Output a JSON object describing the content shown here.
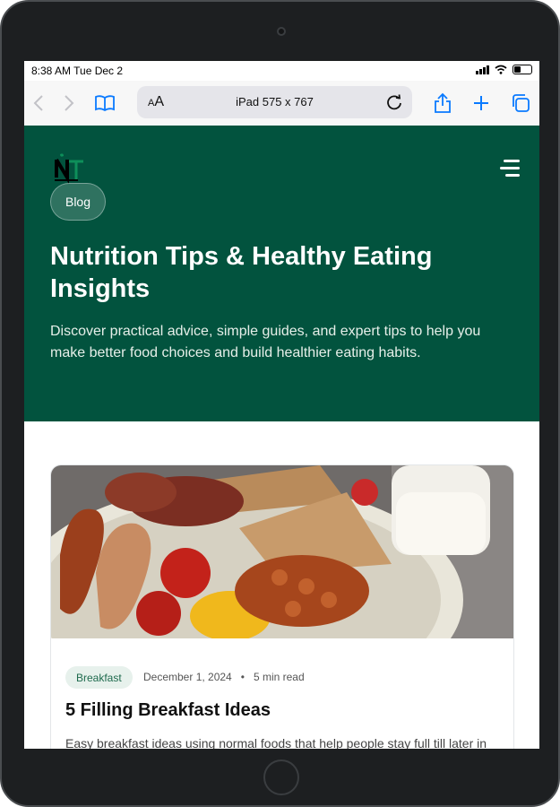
{
  "status_bar": {
    "time": "8:38 AM  Tue Dec 2"
  },
  "browser": {
    "text_size_label": "AA",
    "url_display": "iPad   575 x 767"
  },
  "hero": {
    "badge": "Blog",
    "title": "Nutrition Tips & Healthy Eating Insights",
    "description": "Discover practical advice, simple guides, and expert tips to help you make better food choices and build healthier eating habits."
  },
  "post": {
    "category": "Breakfast",
    "date": "December 1, 2024",
    "separator": "•",
    "read_time": "5 min read",
    "title": "5 Filling Breakfast Ideas",
    "excerpt": "Easy breakfast ideas using normal foods that help people stay full till later in"
  },
  "colors": {
    "brand_green": "#02533e",
    "tag_bg": "#e7f1ec",
    "tag_text": "#1e6a4d"
  }
}
